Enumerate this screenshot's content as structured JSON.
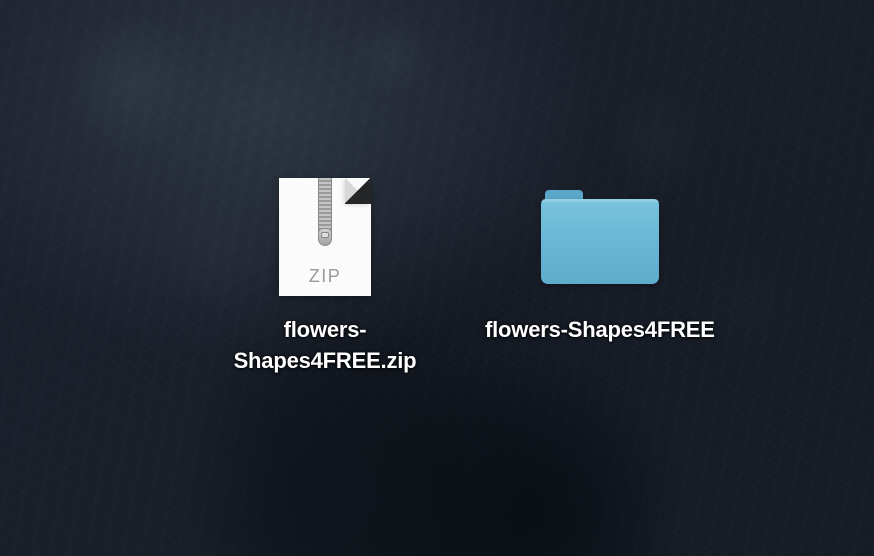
{
  "desktop": {
    "items": [
      {
        "type": "zip",
        "label": "flowers-Shapes4FREE.zip",
        "badge": "ZIP"
      },
      {
        "type": "folder",
        "label": "flowers-Shapes4FREE"
      }
    ]
  }
}
